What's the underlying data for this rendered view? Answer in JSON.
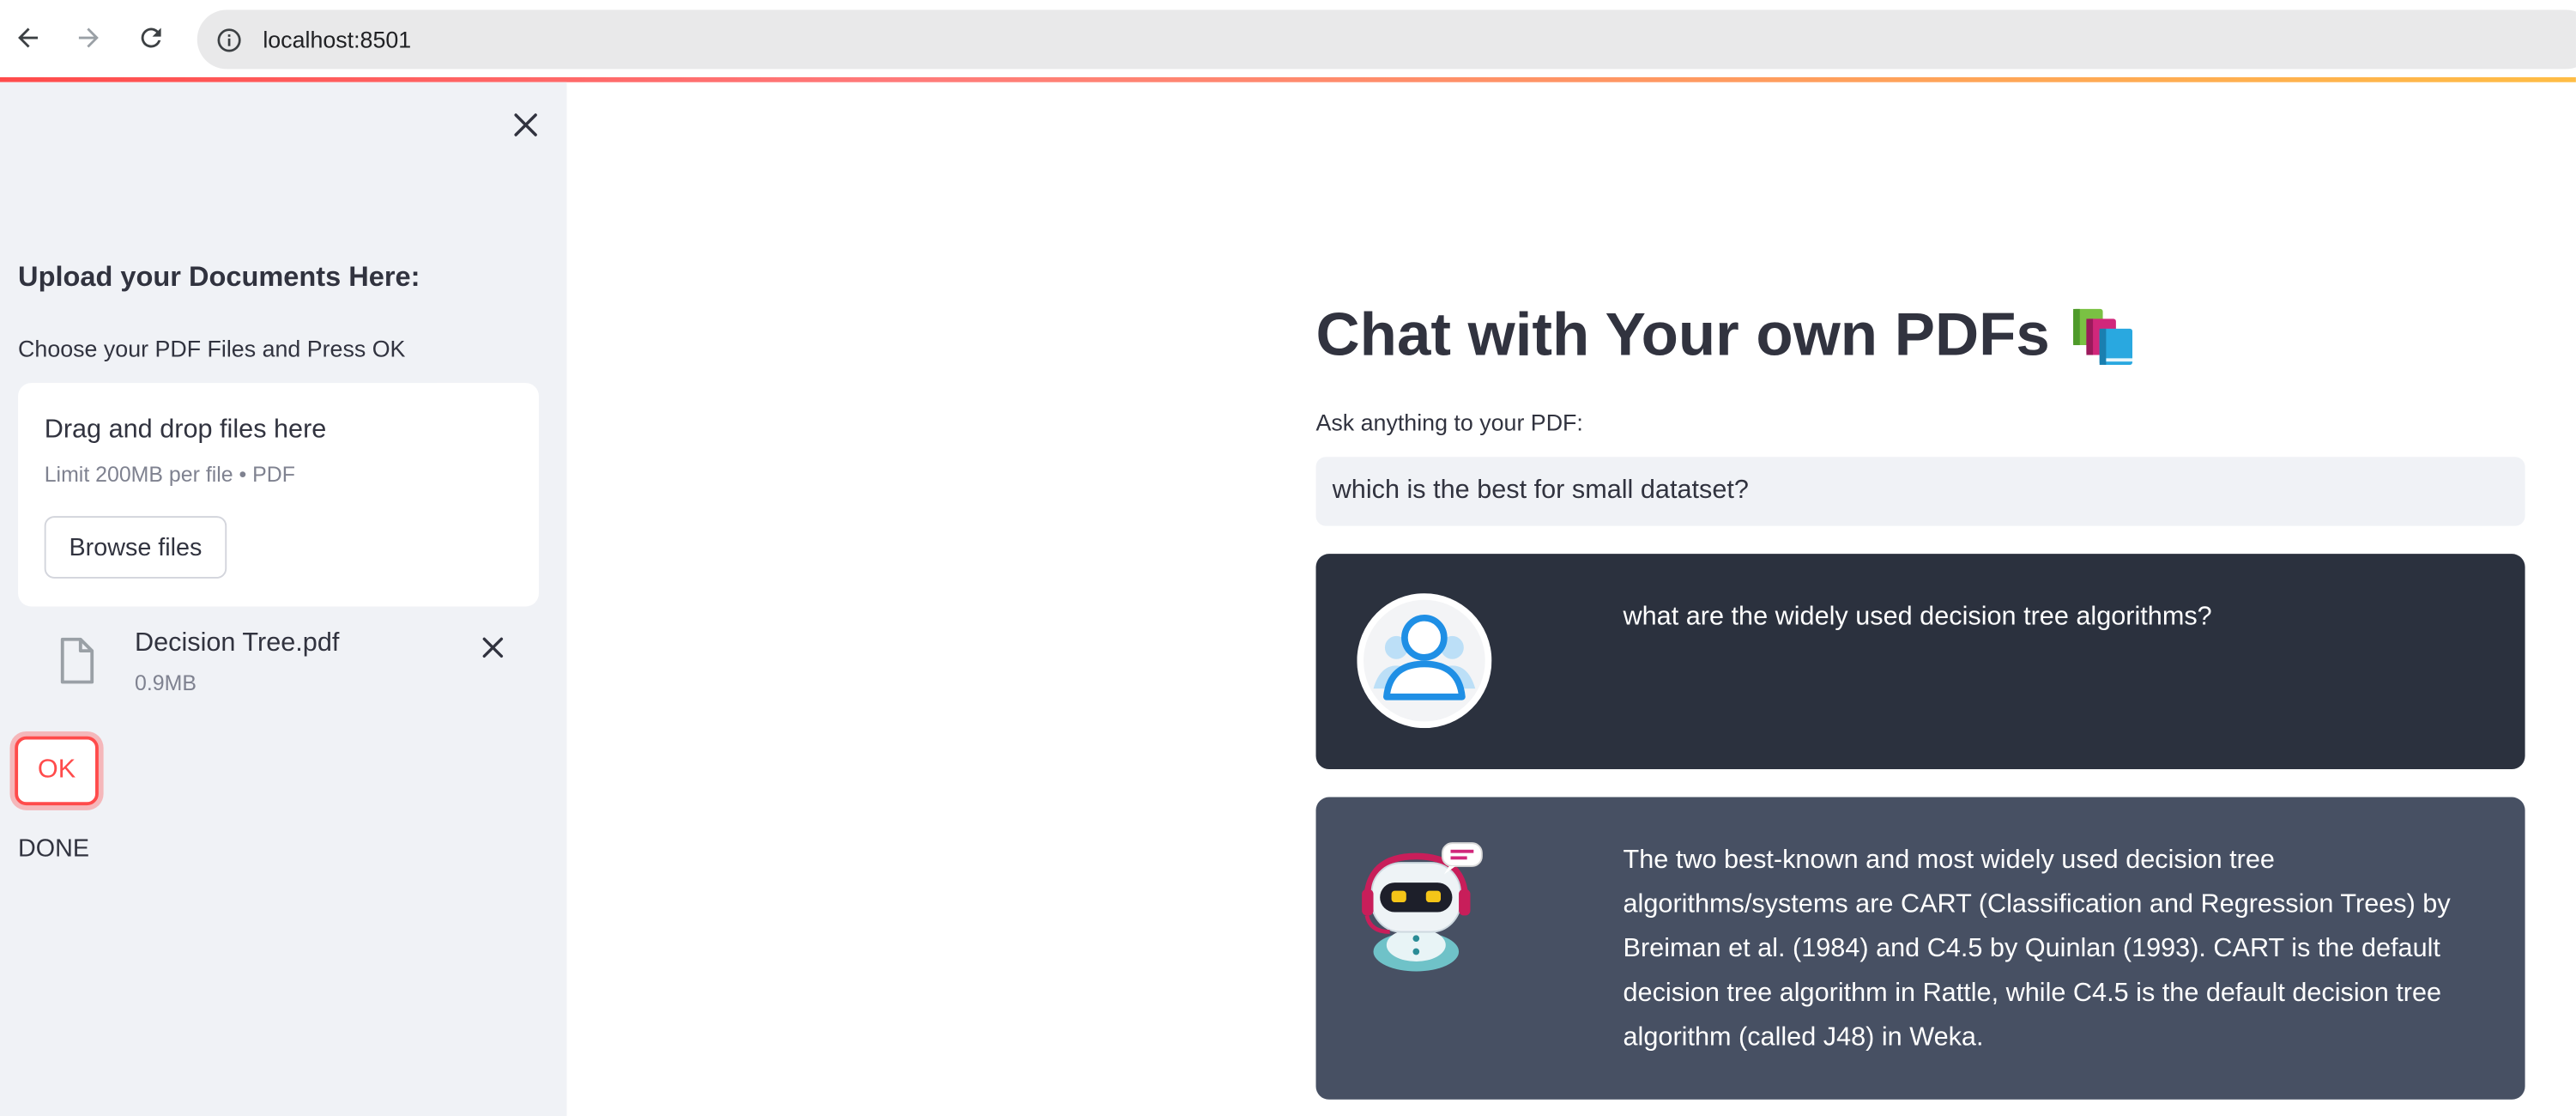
{
  "browser": {
    "url": "localhost:8501"
  },
  "sidebar": {
    "header": "Upload your Documents Here:",
    "uploader_label": "Choose your PDF Files and Press OK",
    "dropzone_title": "Drag and drop files here",
    "dropzone_limit": "Limit 200MB per file • PDF",
    "browse_label": "Browse files",
    "file": {
      "name": "Decision Tree.pdf",
      "size": "0.9MB"
    },
    "ok_label": "OK",
    "status": "DONE"
  },
  "main": {
    "title": "Chat with Your own PDFs",
    "input_label": "Ask anything to your PDF:",
    "input_value": "which is the best for small datatset?",
    "messages": [
      {
        "role": "user",
        "text": "what are the widely used decision tree algorithms?"
      },
      {
        "role": "bot",
        "text": "The two best-known and most widely used decision tree algorithms/systems are CART (Classification and Regression Trees) by Breiman et al. (1984) and C4.5 by Quinlan (1993). CART is the default decision tree algorithm in Rattle, while C4.5 is the default decision tree algorithm (called J48) in Weka."
      }
    ]
  },
  "icons": {
    "back": "arrow-left-icon",
    "forward": "arrow-right-icon",
    "reload": "reload-icon",
    "site_info": "info-icon",
    "sidebar_close": "close-icon",
    "file": "file-icon",
    "file_remove": "close-icon",
    "title_emoji": "books-icon",
    "user_avatar": "user-avatar-icon",
    "bot_avatar": "robot-avatar-icon"
  },
  "colors": {
    "accent": "#ff4b4b",
    "sidebar_bg": "#f0f2f6",
    "user_msg_bg": "#2b313e",
    "bot_msg_bg": "#475063"
  }
}
